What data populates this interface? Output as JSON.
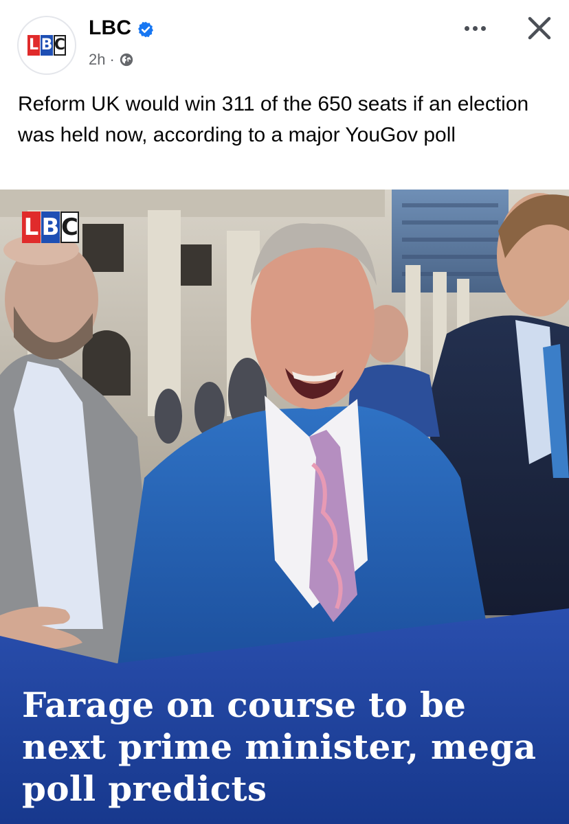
{
  "post": {
    "page_name": "LBC",
    "time": "2h",
    "separator": "·",
    "caption": "Reform UK would win 311 of the 650 seats if an election was held now, according to a major YouGov poll"
  },
  "logo": {
    "letters": [
      "L",
      "B",
      "C"
    ],
    "colors": {
      "l": "#e02b2b",
      "b": "#1e4fb4",
      "c": "#ffffff"
    }
  },
  "image": {
    "headline": "Farage on course to be next prime minister, mega poll predicts",
    "band_color": "#1d3f9b"
  },
  "icons": {
    "verified": "verified-badge-icon",
    "audience": "globe-icon",
    "more": "more-options-icon",
    "close": "close-icon"
  },
  "colors": {
    "verified_blue": "#1877f2",
    "meta_gray": "#65676b"
  }
}
